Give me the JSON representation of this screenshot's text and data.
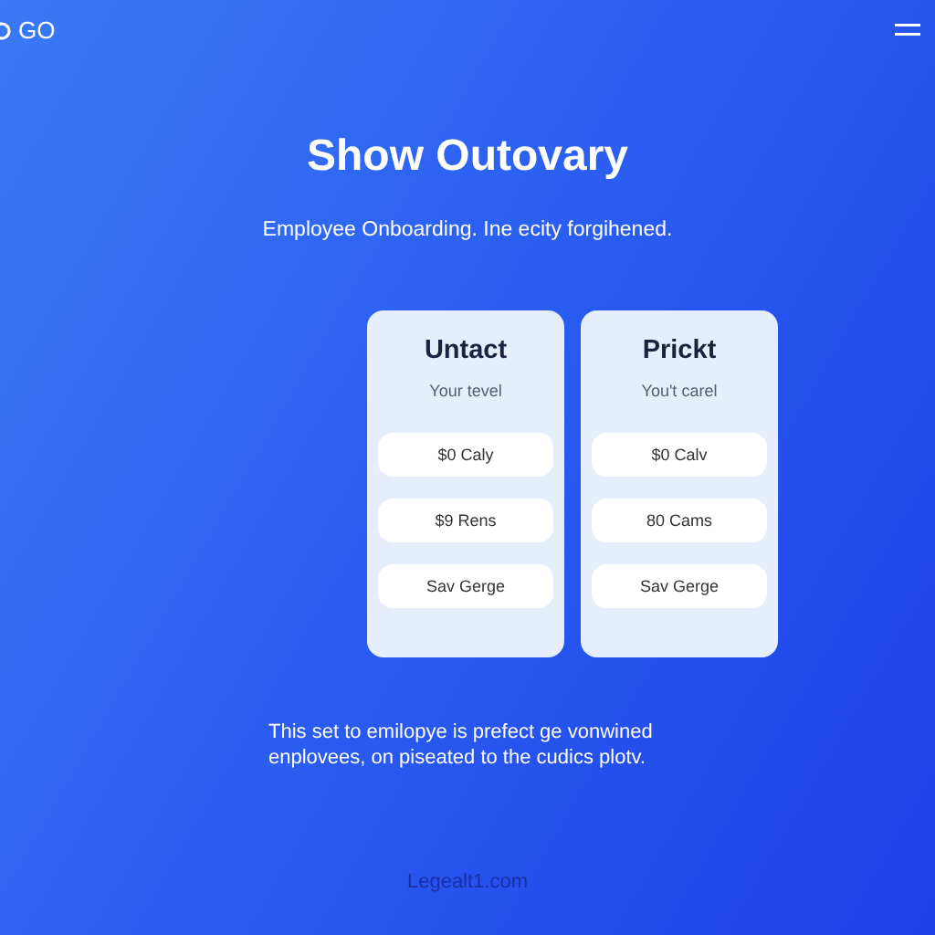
{
  "header": {
    "logo": "GO"
  },
  "hero": {
    "title": "Show Outovary",
    "subtitle": "Employee Onboarding. Ine ecity forgihened."
  },
  "cards": [
    {
      "title": "Untact",
      "subtitle": "Your tevel",
      "options": [
        "$0 Caly",
        "$9 Rens",
        "Sav Gerge"
      ]
    },
    {
      "title": "Prickt",
      "subtitle": "You't carel",
      "options": [
        "$0 Calv",
        "80 Cams",
        "Sav Gerge"
      ]
    }
  ],
  "description": "This set to emilopye is prefect ge vonwined enplovees, on piseated to the cudics plotv.",
  "footer": {
    "link": "Legealt1.com"
  }
}
